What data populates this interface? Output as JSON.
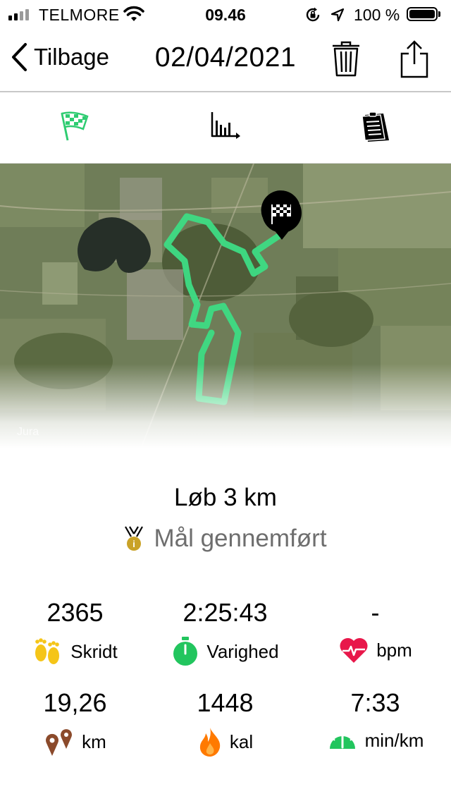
{
  "status_bar": {
    "carrier": "TELMORE",
    "time": "09.46",
    "battery_percent": "100 %",
    "battery_level": 1.0,
    "icons": [
      "signal-icon",
      "wifi-icon",
      "orientation-lock-icon",
      "location-arrow-icon",
      "battery-icon"
    ]
  },
  "nav": {
    "back_label": "Tilbage",
    "title": "02/04/2021",
    "icons": [
      "chevron-left-icon",
      "trash-icon",
      "share-icon"
    ]
  },
  "tabs": {
    "icons": [
      "checkered-flag-icon",
      "bar-chart-icon",
      "notepad-icon"
    ],
    "active_index": 0,
    "active_color": "#2ecc71"
  },
  "map": {
    "attribution": "Jura",
    "route_color": "#3ddc84",
    "icons": [
      "finish-flag-pin-icon"
    ]
  },
  "summary": {
    "activity": "Løb 3 km",
    "goal_status": "Mål gennemført",
    "goal_icon": "medal-icon"
  },
  "stats": [
    {
      "value": "2365",
      "label": "Skridt",
      "icon": "footprints-icon",
      "color": "#f5c518"
    },
    {
      "value": "2:25:43",
      "label": "Varighed",
      "icon": "stopwatch-icon",
      "color": "#22c55e"
    },
    {
      "value": "-",
      "label": "bpm",
      "icon": "heart-icon",
      "color": "#e8174a"
    },
    {
      "value": "19,26",
      "label": "km",
      "icon": "map-pins-icon",
      "color": "#8b4a2b"
    },
    {
      "value": "1448",
      "label": "kal",
      "icon": "flame-icon",
      "color": "#ff7a00"
    },
    {
      "value": "7:33",
      "label": "min/km",
      "icon": "speedometer-icon",
      "color": "#22c55e"
    }
  ]
}
